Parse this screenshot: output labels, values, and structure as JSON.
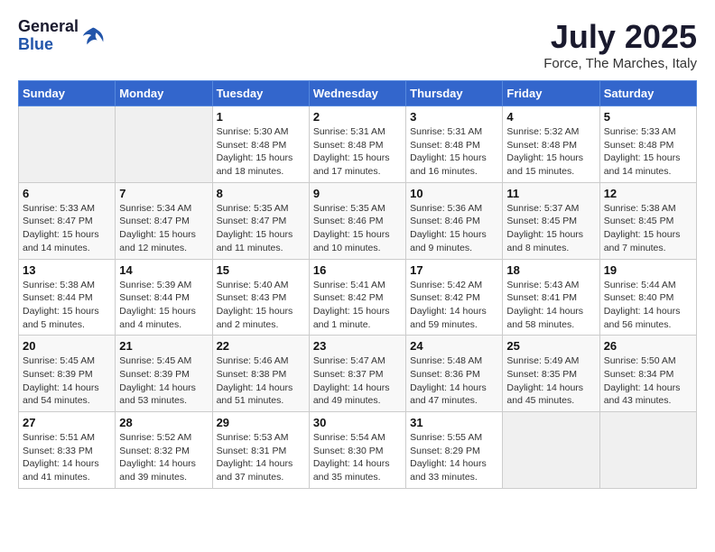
{
  "header": {
    "logo_general": "General",
    "logo_blue": "Blue",
    "month_year": "July 2025",
    "location": "Force, The Marches, Italy"
  },
  "weekdays": [
    "Sunday",
    "Monday",
    "Tuesday",
    "Wednesday",
    "Thursday",
    "Friday",
    "Saturday"
  ],
  "weeks": [
    [
      {
        "day": "",
        "detail": ""
      },
      {
        "day": "",
        "detail": ""
      },
      {
        "day": "1",
        "detail": "Sunrise: 5:30 AM\nSunset: 8:48 PM\nDaylight: 15 hours and 18 minutes."
      },
      {
        "day": "2",
        "detail": "Sunrise: 5:31 AM\nSunset: 8:48 PM\nDaylight: 15 hours and 17 minutes."
      },
      {
        "day": "3",
        "detail": "Sunrise: 5:31 AM\nSunset: 8:48 PM\nDaylight: 15 hours and 16 minutes."
      },
      {
        "day": "4",
        "detail": "Sunrise: 5:32 AM\nSunset: 8:48 PM\nDaylight: 15 hours and 15 minutes."
      },
      {
        "day": "5",
        "detail": "Sunrise: 5:33 AM\nSunset: 8:48 PM\nDaylight: 15 hours and 14 minutes."
      }
    ],
    [
      {
        "day": "6",
        "detail": "Sunrise: 5:33 AM\nSunset: 8:47 PM\nDaylight: 15 hours and 14 minutes."
      },
      {
        "day": "7",
        "detail": "Sunrise: 5:34 AM\nSunset: 8:47 PM\nDaylight: 15 hours and 12 minutes."
      },
      {
        "day": "8",
        "detail": "Sunrise: 5:35 AM\nSunset: 8:47 PM\nDaylight: 15 hours and 11 minutes."
      },
      {
        "day": "9",
        "detail": "Sunrise: 5:35 AM\nSunset: 8:46 PM\nDaylight: 15 hours and 10 minutes."
      },
      {
        "day": "10",
        "detail": "Sunrise: 5:36 AM\nSunset: 8:46 PM\nDaylight: 15 hours and 9 minutes."
      },
      {
        "day": "11",
        "detail": "Sunrise: 5:37 AM\nSunset: 8:45 PM\nDaylight: 15 hours and 8 minutes."
      },
      {
        "day": "12",
        "detail": "Sunrise: 5:38 AM\nSunset: 8:45 PM\nDaylight: 15 hours and 7 minutes."
      }
    ],
    [
      {
        "day": "13",
        "detail": "Sunrise: 5:38 AM\nSunset: 8:44 PM\nDaylight: 15 hours and 5 minutes."
      },
      {
        "day": "14",
        "detail": "Sunrise: 5:39 AM\nSunset: 8:44 PM\nDaylight: 15 hours and 4 minutes."
      },
      {
        "day": "15",
        "detail": "Sunrise: 5:40 AM\nSunset: 8:43 PM\nDaylight: 15 hours and 2 minutes."
      },
      {
        "day": "16",
        "detail": "Sunrise: 5:41 AM\nSunset: 8:42 PM\nDaylight: 15 hours and 1 minute."
      },
      {
        "day": "17",
        "detail": "Sunrise: 5:42 AM\nSunset: 8:42 PM\nDaylight: 14 hours and 59 minutes."
      },
      {
        "day": "18",
        "detail": "Sunrise: 5:43 AM\nSunset: 8:41 PM\nDaylight: 14 hours and 58 minutes."
      },
      {
        "day": "19",
        "detail": "Sunrise: 5:44 AM\nSunset: 8:40 PM\nDaylight: 14 hours and 56 minutes."
      }
    ],
    [
      {
        "day": "20",
        "detail": "Sunrise: 5:45 AM\nSunset: 8:39 PM\nDaylight: 14 hours and 54 minutes."
      },
      {
        "day": "21",
        "detail": "Sunrise: 5:45 AM\nSunset: 8:39 PM\nDaylight: 14 hours and 53 minutes."
      },
      {
        "day": "22",
        "detail": "Sunrise: 5:46 AM\nSunset: 8:38 PM\nDaylight: 14 hours and 51 minutes."
      },
      {
        "day": "23",
        "detail": "Sunrise: 5:47 AM\nSunset: 8:37 PM\nDaylight: 14 hours and 49 minutes."
      },
      {
        "day": "24",
        "detail": "Sunrise: 5:48 AM\nSunset: 8:36 PM\nDaylight: 14 hours and 47 minutes."
      },
      {
        "day": "25",
        "detail": "Sunrise: 5:49 AM\nSunset: 8:35 PM\nDaylight: 14 hours and 45 minutes."
      },
      {
        "day": "26",
        "detail": "Sunrise: 5:50 AM\nSunset: 8:34 PM\nDaylight: 14 hours and 43 minutes."
      }
    ],
    [
      {
        "day": "27",
        "detail": "Sunrise: 5:51 AM\nSunset: 8:33 PM\nDaylight: 14 hours and 41 minutes."
      },
      {
        "day": "28",
        "detail": "Sunrise: 5:52 AM\nSunset: 8:32 PM\nDaylight: 14 hours and 39 minutes."
      },
      {
        "day": "29",
        "detail": "Sunrise: 5:53 AM\nSunset: 8:31 PM\nDaylight: 14 hours and 37 minutes."
      },
      {
        "day": "30",
        "detail": "Sunrise: 5:54 AM\nSunset: 8:30 PM\nDaylight: 14 hours and 35 minutes."
      },
      {
        "day": "31",
        "detail": "Sunrise: 5:55 AM\nSunset: 8:29 PM\nDaylight: 14 hours and 33 minutes."
      },
      {
        "day": "",
        "detail": ""
      },
      {
        "day": "",
        "detail": ""
      }
    ]
  ]
}
